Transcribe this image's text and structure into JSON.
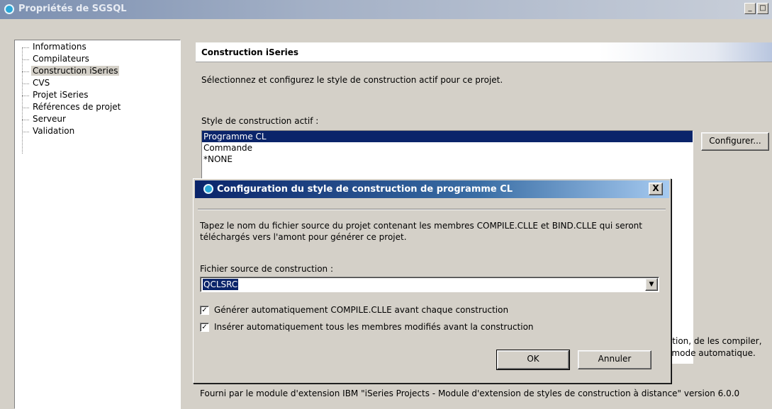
{
  "window": {
    "title": "Propriétés de SGSQL",
    "minimize_label": "_",
    "maximize_label": "□"
  },
  "tree": {
    "items": [
      {
        "label": "Informations"
      },
      {
        "label": "Compilateurs"
      },
      {
        "label": "Construction iSeries"
      },
      {
        "label": "CVS"
      },
      {
        "label": "Projet iSeries"
      },
      {
        "label": "Références de projet"
      },
      {
        "label": "Serveur"
      },
      {
        "label": "Validation"
      }
    ],
    "selected": "Construction iSeries"
  },
  "panel": {
    "header": "Construction iSeries",
    "description": "Sélectionnez et configurez le style de construction actif pour ce projet.",
    "active_style_label": "Style de construction actif :",
    "styles": [
      "Programme CL",
      "Commande",
      "*NONE"
    ],
    "selected_style": "Programme CL",
    "configure_button": "Configurer...",
    "partial_text_1": "ration, de les compiler,",
    "partial_text_2": "n mode automatique.",
    "footer": "Fourni par le module d'extension IBM \"iSeries Projects - Module d'extension de styles de construction à distance\" version 6.0.0"
  },
  "dialog": {
    "title": "Configuration du style de construction de programme CL",
    "close_label": "X",
    "description": "Tapez le nom du fichier source du projet contenant les membres COMPILE.CLLE et BIND.CLLE qui seront téléchargés vers l'amont pour générer ce projet.",
    "source_file_label": "Fichier source de construction :",
    "source_file_value": "QCLSRC",
    "checkbox_1": {
      "label": "Générer automatiquement COMPILE.CLLE avant chaque construction",
      "checked": true
    },
    "checkbox_2": {
      "label": "Insérer automatiquement tous les membres modifiés avant la construction",
      "checked": true
    },
    "check_mark": "✓",
    "ok_button": "OK",
    "cancel_button": "Annuler",
    "dropdown_arrow": "▼"
  }
}
